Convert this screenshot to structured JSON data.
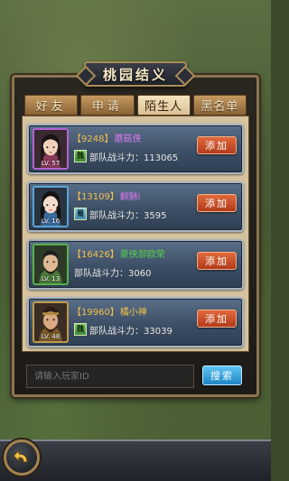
{
  "title": "桃园结义",
  "tabs": [
    {
      "label": "好友",
      "active": false
    },
    {
      "label": "申请",
      "active": false
    },
    {
      "label": "陌生人",
      "active": true
    },
    {
      "label": "黑名单",
      "active": false
    }
  ],
  "players": [
    {
      "id": "【9248】",
      "name": "蘑菇侠",
      "level": "LV. 57",
      "nation": "魏",
      "power_label": "部队战斗力：",
      "power": "113065",
      "add_label": "添加",
      "name_color": "purple",
      "frame": "purple"
    },
    {
      "id": "【13109】",
      "name": "翻魅i",
      "level": "LV. 16",
      "nation": "蜀",
      "power_label": "部队战斗力：",
      "power": "3595",
      "add_label": "添加",
      "name_color": "purple",
      "frame": "blue"
    },
    {
      "id": "【16426】",
      "name": "豪侠部欧荣",
      "level": "LV. 13",
      "nation": "",
      "power_label": "部队战斗力：",
      "power": "3060",
      "add_label": "添加",
      "name_color": "green",
      "frame": "green"
    },
    {
      "id": "【19960】",
      "name": "橘小神",
      "level": "LV. 48",
      "nation": "魏",
      "power_label": "部队战斗力：",
      "power": "33039",
      "add_label": "添加",
      "name_color": "orange",
      "frame": "gold"
    }
  ],
  "search": {
    "placeholder": "请输入玩家ID",
    "button_label": "搜索"
  },
  "colors": {
    "accent_gold": "#a98c58",
    "add_button": "#c84a24",
    "search_button": "#2a9bd8"
  }
}
